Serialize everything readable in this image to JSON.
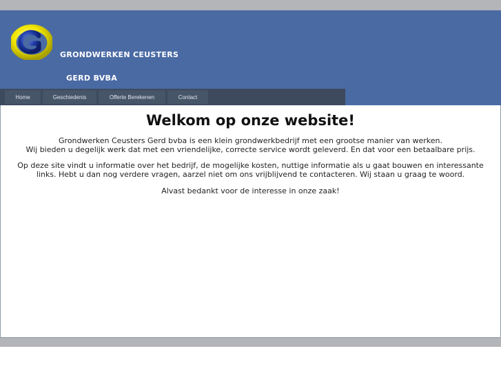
{
  "header": {
    "company_line1": "GRONDWERKEN CEUSTERS",
    "company_line2": "GERD BVBA"
  },
  "nav": {
    "items": [
      {
        "label": "Home"
      },
      {
        "label": "Geschiedenis"
      },
      {
        "label": "Offerte Berekenen"
      },
      {
        "label": "Contact"
      }
    ]
  },
  "main": {
    "title": "Welkom op onze website!",
    "intro_line1": "Grondwerken Ceusters Gerd bvba is een klein grondwerkbedrijf met een grootse manier van werken.",
    "intro_line2": "Wij bieden u degelijk werk dat met een vriendelijke, correcte service wordt geleverd. En dat voor een betaalbare prijs.",
    "info_line1": "Op deze site vindt u informatie over het bedrijf, de mogelijke kosten, nuttige informatie als u gaat bouwen en interessante",
    "info_line2": "links. Hebt u dan nog verdere vragen, aarzel niet om ons vrijblijvend te contacteren. Wij staan u graag te woord.",
    "thanks": "Alvast bedankt voor de interesse in onze zaak!"
  },
  "colors": {
    "header_bg": "#4a6aa4",
    "nav_bg": "#3d4a5e",
    "band_gray": "#b4b5b8",
    "logo_yellow": "#f2e600"
  }
}
